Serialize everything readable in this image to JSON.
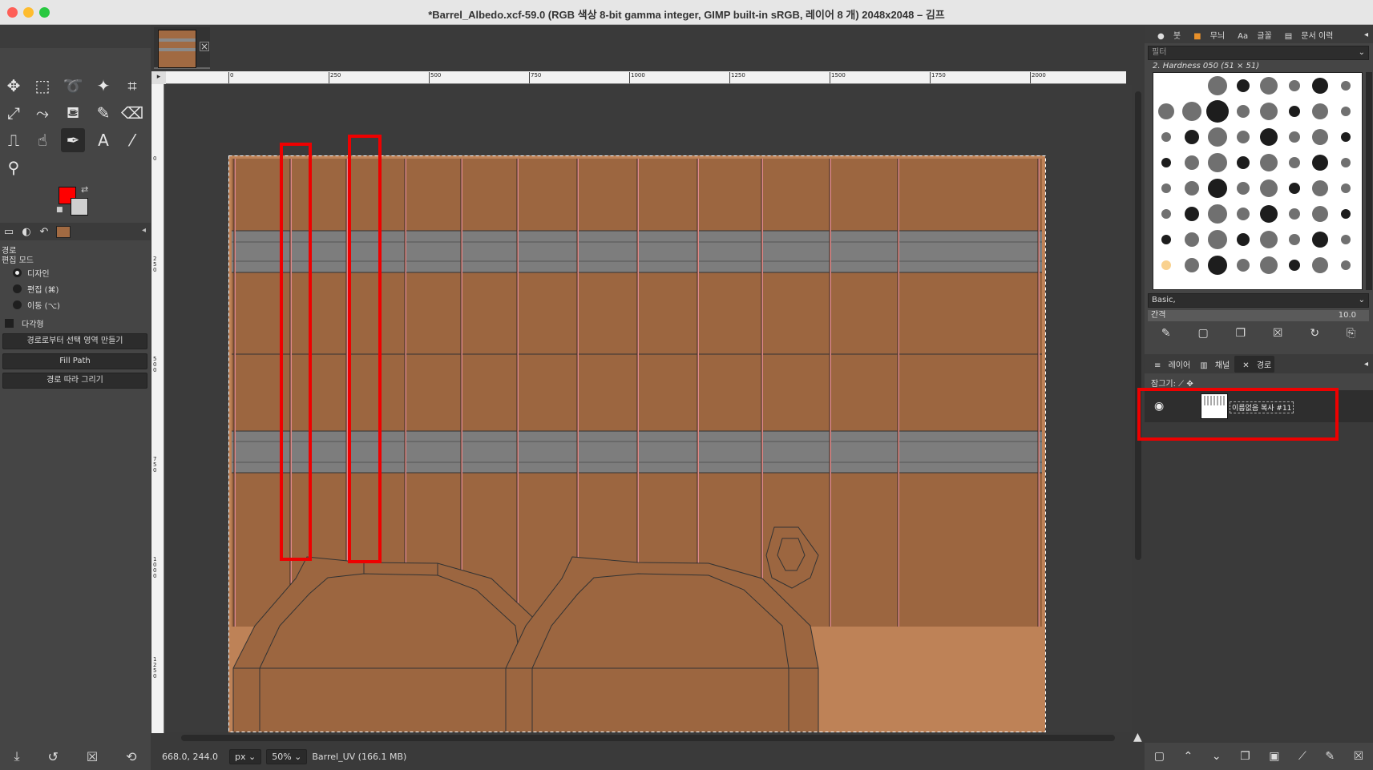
{
  "window": {
    "title": "*Barrel_Albedo.xcf-59.0 (RGB 색상 8-bit gamma integer, GIMP built-in sRGB, 레이어 8 개) 2048x2048 – 김프"
  },
  "colors": {
    "foreground": "#ff0000",
    "background": "#cfcfcf",
    "wood": "#9c6640",
    "wood_light": "#be8257",
    "band": "#7d7d7d",
    "highlight": "#ee0000"
  },
  "tools": [
    {
      "name": "move-tool-icon",
      "glyph": "✥"
    },
    {
      "name": "rect-select-icon",
      "glyph": "⬚"
    },
    {
      "name": "lasso-icon",
      "glyph": "➰"
    },
    {
      "name": "fuzzy-select-icon",
      "glyph": "✦"
    },
    {
      "name": "crop-icon",
      "glyph": "⌗"
    },
    {
      "name": "transform-icon",
      "glyph": "⤢"
    },
    {
      "name": "warp-icon",
      "glyph": "⤳"
    },
    {
      "name": "bucket-fill-icon",
      "glyph": "⛾"
    },
    {
      "name": "paintbrush-icon",
      "glyph": "✎"
    },
    {
      "name": "eraser-icon",
      "glyph": "⌫"
    },
    {
      "name": "clone-icon",
      "glyph": "⎍"
    },
    {
      "name": "smudge-icon",
      "glyph": "☝"
    },
    {
      "name": "paths-tool-icon",
      "glyph": "✒"
    },
    {
      "name": "text-tool-icon",
      "glyph": "A"
    },
    {
      "name": "color-picker-icon",
      "glyph": "⁄"
    },
    {
      "name": "zoom-icon",
      "glyph": "⚲"
    }
  ],
  "tool_options": {
    "title": "경로",
    "mode_label": "편집 모드",
    "modes": [
      "디자인",
      "편집 (⌘)",
      "이동 (⌥)"
    ],
    "polygon_label": "다각형",
    "buttons": [
      "경로로부터 선택 영역 만들기",
      "Fill Path",
      "경로 따라 그리기"
    ]
  },
  "ruler": {
    "top_labels": [
      "0",
      "250",
      "500",
      "750",
      "1000",
      "1250",
      "1500",
      "1750",
      "2000"
    ],
    "left_labels": [
      "0",
      "250",
      "500",
      "750",
      "1000",
      "1250"
    ]
  },
  "status": {
    "coords": "668.0, 244.0",
    "unit": "px",
    "zoom": "50%",
    "layer_info": "Barrel_UV (166.1 MB)"
  },
  "right_panel": {
    "tabs": [
      "붓",
      "무늬",
      "글꼴",
      "문서 이력"
    ],
    "filter_placeholder": "필터",
    "brush_name": "2. Hardness 050 (51 × 51)",
    "brush_set": "Basic,",
    "spacing_label": "간격",
    "spacing_value": "10.0",
    "layer_tabs": [
      "레이어",
      "채널",
      "경로"
    ],
    "lock_label": "잠그기:",
    "path_name": "이름없음 복사 #11"
  }
}
